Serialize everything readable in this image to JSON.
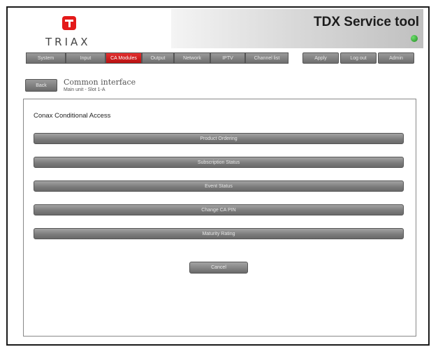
{
  "brand": {
    "name": "TRIAX",
    "logo_icon": "triax-logo-icon",
    "logo_color": "#e41a1a"
  },
  "header": {
    "title": "TDX Service tool",
    "status_color": "#2a9a2a"
  },
  "tabs": [
    {
      "label": "System",
      "active": false
    },
    {
      "label": "Input",
      "active": false
    },
    {
      "label": "CA Modules",
      "active": true
    },
    {
      "label": "Output",
      "active": false
    },
    {
      "label": "Network",
      "active": false
    },
    {
      "label": "IPTV",
      "active": false
    },
    {
      "label": "Channel list",
      "active": false
    }
  ],
  "actions": {
    "apply": "Apply",
    "log_out": "Log out",
    "admin": "Admin"
  },
  "breadcrumb": {
    "back_label": "Back",
    "title": "Common interface",
    "subtitle": "Main unit - Slot 1-A"
  },
  "panel": {
    "title": "Conax Conditional Access",
    "items": [
      "Product Ordering",
      "Subscription Status",
      "Event Status",
      "Change CA PIN",
      "Maturity Rating"
    ],
    "cancel_label": "Cancel"
  },
  "colors": {
    "active_tab": "#d42020",
    "button": "#7a7a7a"
  }
}
